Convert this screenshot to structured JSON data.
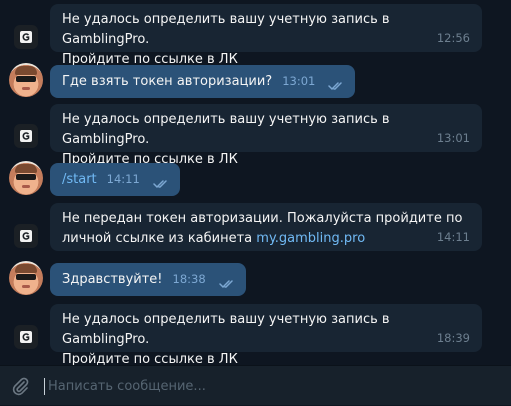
{
  "colors": {
    "background": "#0e1621",
    "incoming_bubble": "#182533",
    "outgoing_bubble": "#2b5278",
    "link": "#71baf5",
    "composer": "#17212b"
  },
  "messages": [
    {
      "sender": "bot",
      "text_line1": "Не удалось определить вашу учетную запись в GamblingPro.",
      "text_line2": "Пройдите по ссылке в ЛК",
      "time": "12:56"
    },
    {
      "sender": "user",
      "text": "Где взять токен авторизации?",
      "time": "13:01",
      "status": "read"
    },
    {
      "sender": "bot",
      "text_line1": "Не удалось определить вашу учетную запись в GamblingPro.",
      "text_line2": "Пройдите по ссылке в ЛК",
      "time": "13:01"
    },
    {
      "sender": "user",
      "text": "/start",
      "time": "14:11",
      "status": "read"
    },
    {
      "sender": "bot",
      "text_line1": "Не передан токен авторизации. Пожалуйста пройдите по",
      "text_line2": "личной ссылке из кабинета ",
      "link": "my.gambling.pro",
      "time": "14:11"
    },
    {
      "sender": "user",
      "text": "Здравствуйте!",
      "time": "18:38",
      "status": "read"
    },
    {
      "sender": "bot",
      "text_line1": "Не удалось определить вашу учетную запись в GamblingPro.",
      "text_line2": "Пройдите по ссылке в ЛК",
      "time": "18:39"
    }
  ],
  "composer": {
    "placeholder": "Написать сообщение...",
    "attach_icon": "paperclip-icon"
  },
  "avatars": {
    "bot_icon": "gambling-bot-logo",
    "user_icon": "user-avatar-photo"
  }
}
